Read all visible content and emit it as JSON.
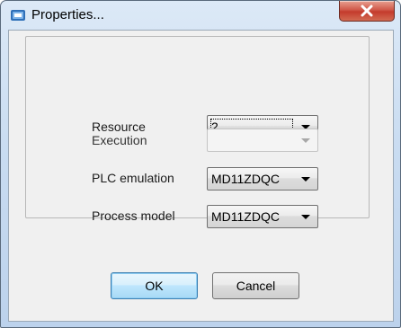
{
  "window": {
    "title": "Properties..."
  },
  "form": {
    "resource": {
      "label": "Resource",
      "value": "2"
    },
    "execution": {
      "label": "Execution",
      "value": ""
    },
    "plc_emulation": {
      "label": "PLC emulation",
      "value": "MD11ZDQC"
    },
    "process_model": {
      "label": "Process model",
      "value": "MD11ZDQC"
    }
  },
  "buttons": {
    "ok_label": "OK",
    "cancel_label": "Cancel"
  },
  "icons": {
    "app": "emu-app-icon",
    "close": "close-icon",
    "dropdown": "chevron-down-icon"
  },
  "colors": {
    "close_button": "#c43b2c",
    "default_button_border": "#3c7fb1"
  }
}
